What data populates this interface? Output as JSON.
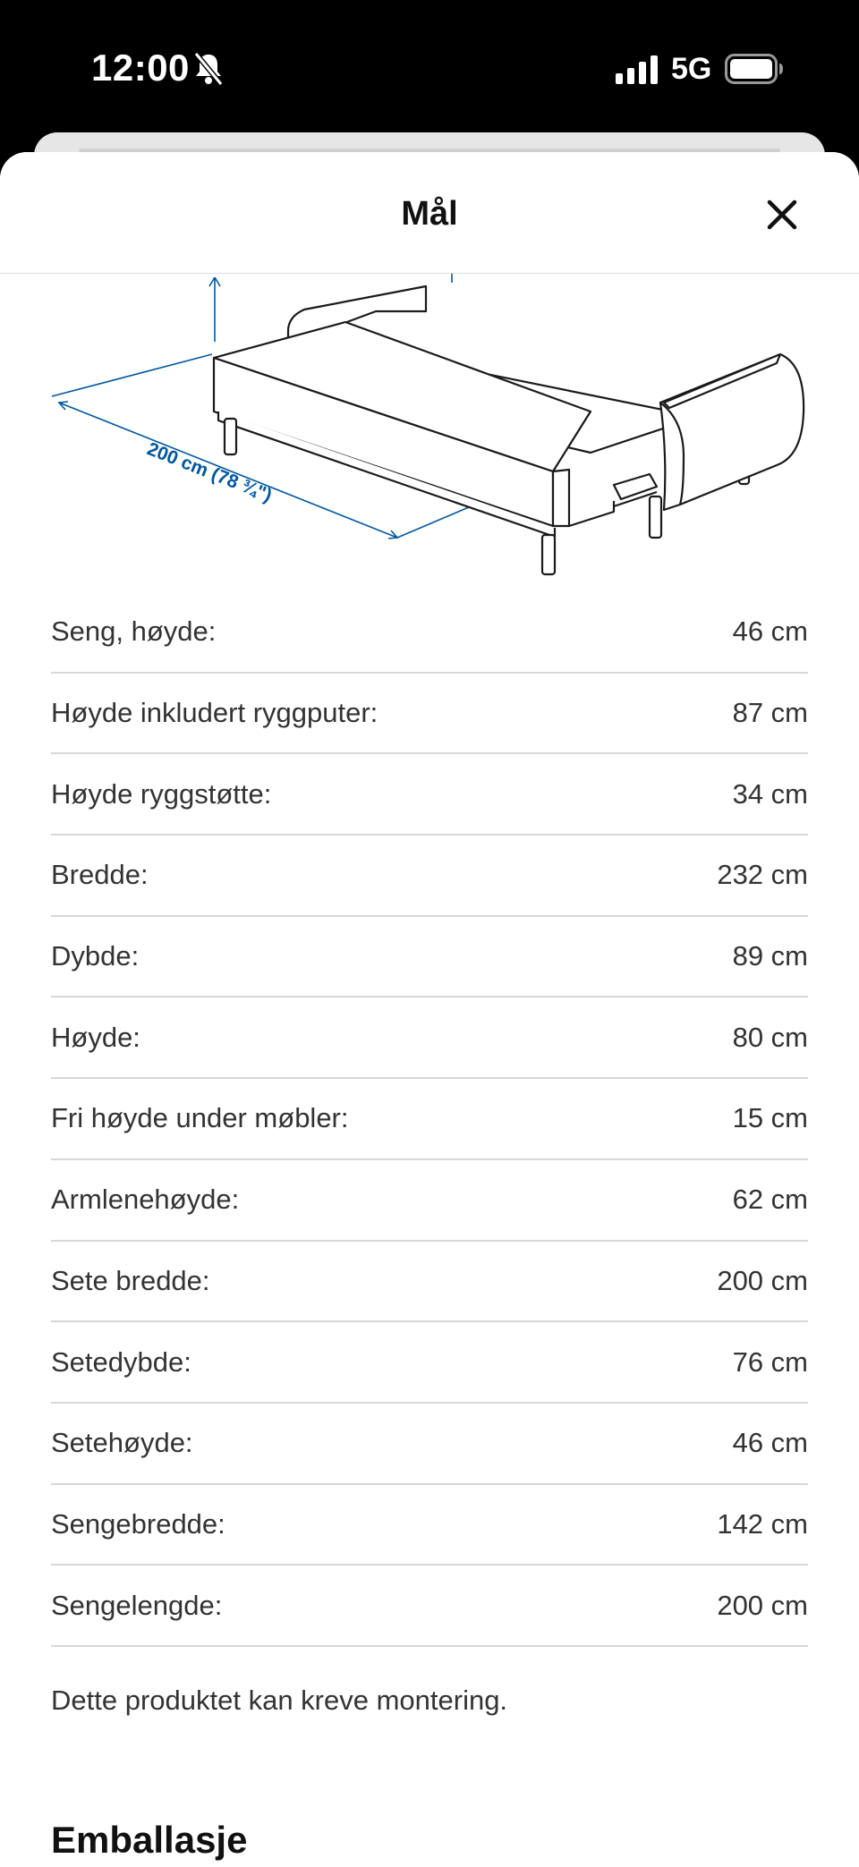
{
  "status_bar": {
    "time": "12:00",
    "network": "5G",
    "icons": [
      "bell-slash-icon",
      "signal-icon",
      "battery-icon"
    ]
  },
  "sheet": {
    "title": "Mål",
    "close_icon": "close-icon"
  },
  "illustration": {
    "dimension_label": "200 cm (78 ¾\")",
    "accent_color": "#0058a3"
  },
  "dimensions": [
    {
      "label": "Seng, høyde:",
      "value": "46 cm"
    },
    {
      "label": "Høyde inkludert ryggputer:",
      "value": "87 cm"
    },
    {
      "label": "Høyde ryggstøtte:",
      "value": "34 cm"
    },
    {
      "label": "Bredde:",
      "value": "232 cm"
    },
    {
      "label": "Dybde:",
      "value": "89 cm"
    },
    {
      "label": "Høyde:",
      "value": "80 cm"
    },
    {
      "label": "Fri høyde under møbler:",
      "value": "15 cm"
    },
    {
      "label": "Armlenehøyde:",
      "value": "62 cm"
    },
    {
      "label": "Sete bredde:",
      "value": "200 cm"
    },
    {
      "label": "Setedybde:",
      "value": "76 cm"
    },
    {
      "label": "Setehøyde:",
      "value": "46 cm"
    },
    {
      "label": "Sengebredde:",
      "value": "142 cm"
    },
    {
      "label": "Sengelengde:",
      "value": "200 cm"
    }
  ],
  "note": "Dette produktet kan kreve montering.",
  "next_section_title": "Emballasje"
}
